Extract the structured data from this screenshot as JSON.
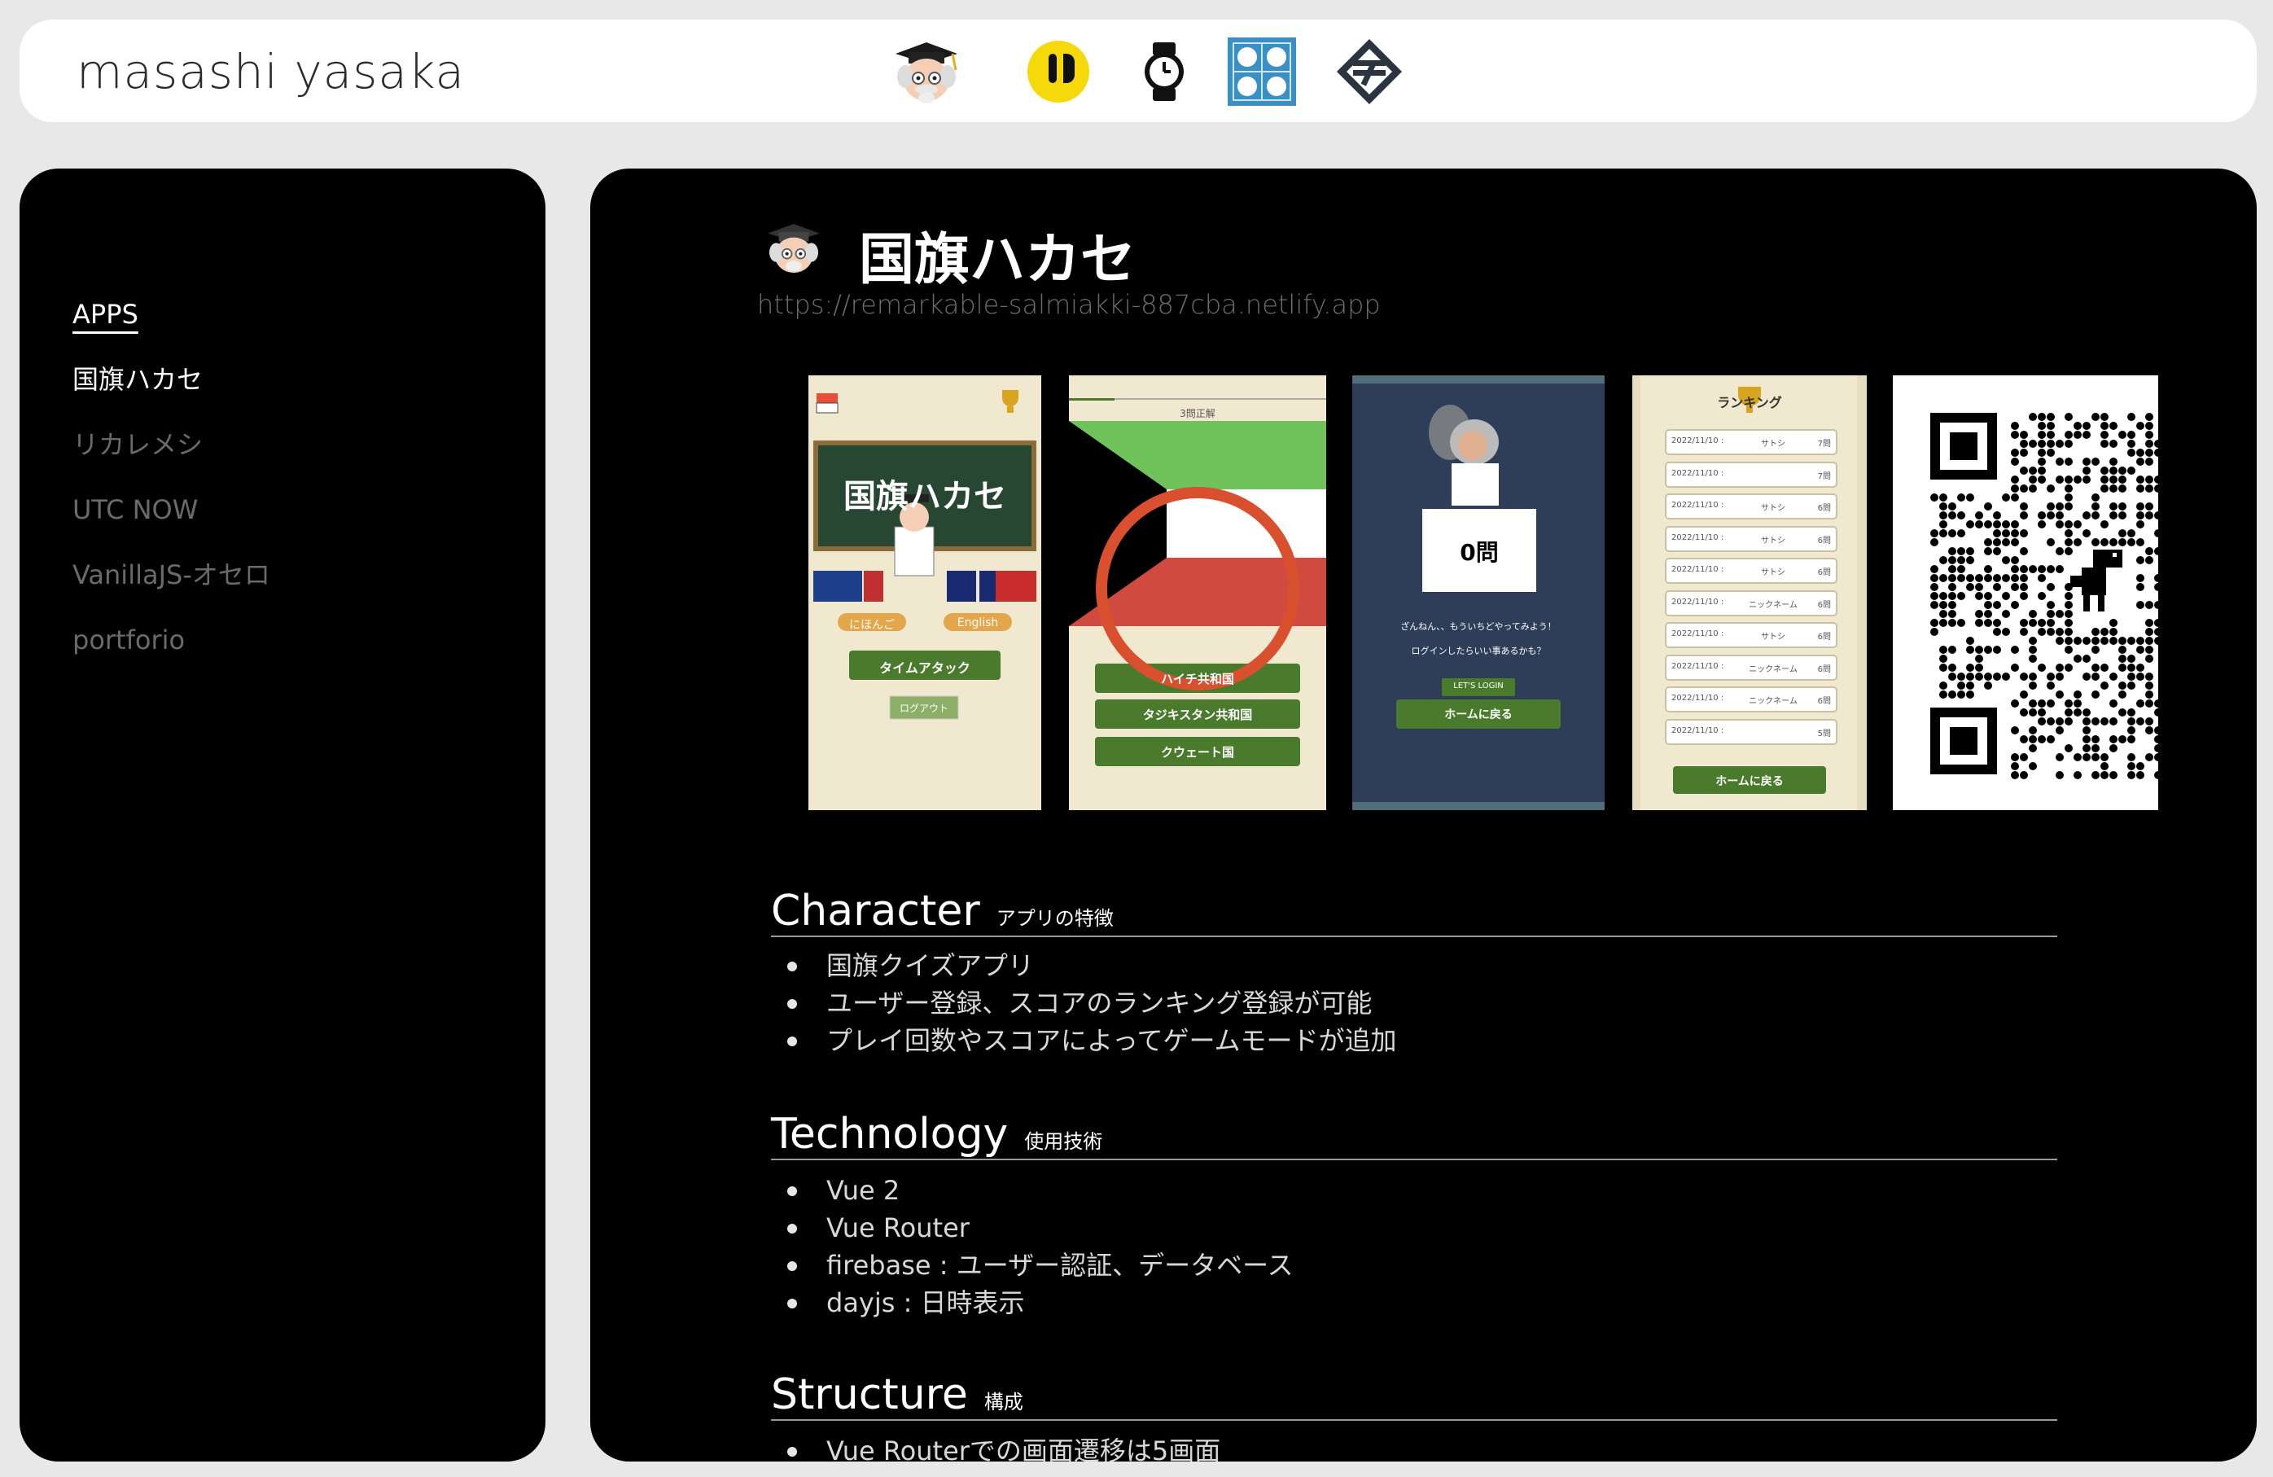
{
  "header": {
    "site_title": "masashi yasaka",
    "app_icons": [
      {
        "name": "flag-hakase-icon"
      },
      {
        "name": "rikaremeshi-icon"
      },
      {
        "name": "utc-now-icon"
      },
      {
        "name": "othello-icon"
      },
      {
        "name": "portfolio-icon"
      }
    ]
  },
  "sidebar": {
    "items": [
      {
        "label": "APPS"
      },
      {
        "label": "国旗ハカセ"
      },
      {
        "label": "リカレメシ"
      },
      {
        "label": "UTC NOW"
      },
      {
        "label": "VanillaJS-オセロ"
      },
      {
        "label": "portforio"
      }
    ]
  },
  "main": {
    "title": "国旗ハカセ",
    "url": "https://remarkable-salmiakki-887cba.netlify.app",
    "screens": {
      "s1": {
        "title": "国旗ハカセ",
        "lang_ja": "にほんご",
        "lang_en": "English",
        "time_attack": "タイムアタック",
        "logout": "ログアウト"
      },
      "s2": {
        "progress": "3問正解",
        "choice1": "ハイチ共和国",
        "choice2": "タジキスタン共和国",
        "choice3": "クウェート国"
      },
      "s3": {
        "score": "0問",
        "msg1": "ざんねん、、もういちどやってみよう！",
        "msg2": "ログインしたらいい事あるかも？",
        "login": "LET'S LOGIN",
        "home": "ホームに戻る"
      },
      "s4": {
        "title": "ランキング",
        "rows": [
          {
            "date": "2022/11/10 :",
            "name": "サトシ",
            "score": "7問"
          },
          {
            "date": "2022/11/10 :",
            "name": "",
            "score": "7問"
          },
          {
            "date": "2022/11/10 :",
            "name": "サトシ",
            "score": "6問"
          },
          {
            "date": "2022/11/10 :",
            "name": "サトシ",
            "score": "6問"
          },
          {
            "date": "2022/11/10 :",
            "name": "サトシ",
            "score": "6問"
          },
          {
            "date": "2022/11/10 :",
            "name": "ニックネーム",
            "score": "6問"
          },
          {
            "date": "2022/11/10 :",
            "name": "サトシ",
            "score": "6問"
          },
          {
            "date": "2022/11/10 :",
            "name": "ニックネーム",
            "score": "6問"
          },
          {
            "date": "2022/11/10 :",
            "name": "ニックネーム",
            "score": "6問"
          },
          {
            "date": "2022/11/10 :",
            "name": "",
            "score": "5問"
          }
        ],
        "home": "ホームに戻る"
      }
    },
    "sections": [
      {
        "heading": "Character",
        "sub": "アプリの特徴",
        "items": [
          "国旗クイズアプリ",
          "ユーザー登録、スコアのランキング登録が可能",
          "プレイ回数やスコアによってゲームモードが追加"
        ]
      },
      {
        "heading": "Technology",
        "sub": "使用技術",
        "items": [
          "Vue 2",
          "Vue Router",
          "firebase : ユーザー認証、データベース",
          "dayjs : 日時表示"
        ]
      },
      {
        "heading": "Structure",
        "sub": "構成",
        "items": [
          "Vue Routerでの画面遷移は5画面"
        ]
      }
    ]
  },
  "colors": {
    "accent_green": "#4a7a2c",
    "red_circle": "#d9502f",
    "panel_blue": "#2e3e58",
    "cream": "#f1e9cf"
  }
}
